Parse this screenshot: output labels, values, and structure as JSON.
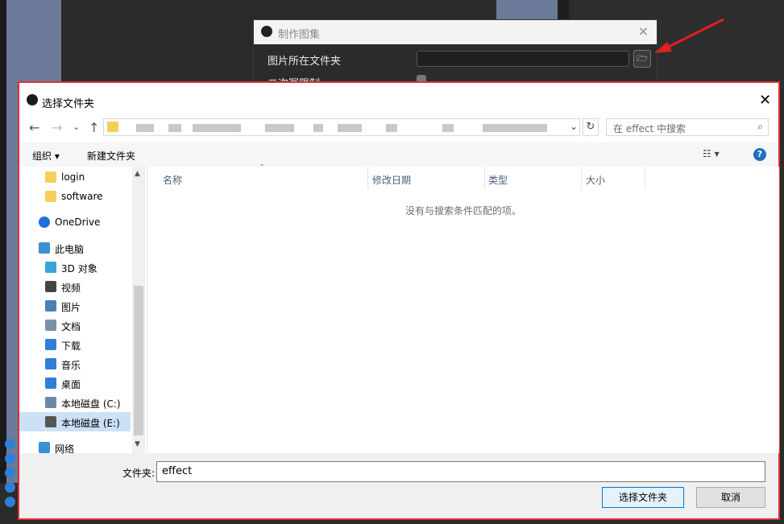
{
  "gallery_dialog": {
    "title": "制作图集",
    "close": "×",
    "folder_label": "图片所在文件夹",
    "secondary_label": "二次写限制"
  },
  "file_dialog": {
    "title": "选择文件夹",
    "close": "✕",
    "nav": {
      "back": "←",
      "forward": "→",
      "recent": "⌄",
      "up": "↑",
      "refresh": "↻",
      "address_dropdown": "⌄"
    },
    "search": {
      "placeholder": "在 effect 中搜索",
      "icon": "search-icon"
    },
    "toolbar": {
      "organize": "组织 ▾",
      "new_folder": "新建文件夹",
      "view": "☷ ▾",
      "help": "?"
    },
    "nav_pane": [
      {
        "label": "login",
        "icon": "folder-icon",
        "color": "#f5cf5a"
      },
      {
        "label": "software",
        "icon": "folder-icon",
        "color": "#f5cf5a"
      },
      {
        "label": "OneDrive",
        "icon": "cloud-icon",
        "color": "#1e6fd9"
      },
      {
        "label": "此电脑",
        "icon": "computer-icon",
        "color": "#3b8fd4"
      },
      {
        "label": "3D 对象",
        "icon": "cube-icon",
        "color": "#3aa6d6"
      },
      {
        "label": "视频",
        "icon": "video-icon",
        "color": "#444444"
      },
      {
        "label": "图片",
        "icon": "pictures-icon",
        "color": "#4a7fb8"
      },
      {
        "label": "文档",
        "icon": "documents-icon",
        "color": "#7a8fa8"
      },
      {
        "label": "下载",
        "icon": "download-icon",
        "color": "#2f7fd6"
      },
      {
        "label": "音乐",
        "icon": "music-icon",
        "color": "#2f7fd6"
      },
      {
        "label": "桌面",
        "icon": "desktop-icon",
        "color": "#2f7fd6"
      },
      {
        "label": "本地磁盘 (C:)",
        "icon": "drive-icon",
        "color": "#6a8aa8"
      },
      {
        "label": "本地磁盘 (E:)",
        "icon": "drive-icon",
        "color": "#555555"
      },
      {
        "label": "网络",
        "icon": "network-icon",
        "color": "#3b8fd4"
      }
    ],
    "columns": [
      "名称",
      "修改日期",
      "类型",
      "大小"
    ],
    "empty_message": "没有与搜索条件匹配的项。",
    "filename_label": "文件夹:",
    "filename_value": "effect",
    "select_button": "选择文件夹",
    "cancel_button": "取消"
  }
}
